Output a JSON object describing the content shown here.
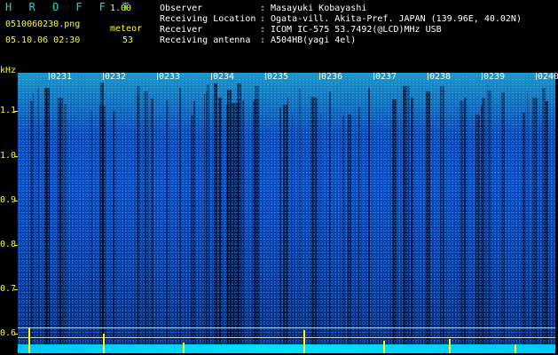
{
  "header": {
    "app_title": "H R O F F T",
    "version": "1.00",
    "filename": "0510060230.png",
    "meteor_label": "meteor",
    "datetime": "05.10.06 02:30",
    "meteor_count": "53"
  },
  "info": [
    {
      "key": "Observer",
      "value": "Masayuki Kobayashi"
    },
    {
      "key": "Receiving Location",
      "value": "Ogata-vill. Akita-Pref. JAPAN (139.96E, 40.02N)"
    },
    {
      "key": "Receiver",
      "value": "ICOM IC-575 53.7492(@LCD)MHz USB"
    },
    {
      "key": "Receiving antenna",
      "value": "A504HB(yagi 4el)"
    }
  ],
  "axis": {
    "y_unit": "kHz",
    "y_ticks": [
      "1.1",
      "1.0",
      "0.9",
      "0.8",
      "0.7",
      "0.6"
    ],
    "x_ticks": [
      "0231",
      "0232",
      "0233",
      "0234",
      "0235",
      "0236",
      "0237",
      "0238",
      "0239",
      "0240"
    ]
  },
  "colors": {
    "label_yellow": "#ffff00",
    "info_white": "#ffffff",
    "title_cyan": "#00e0e0",
    "spectrogram_blue": "#0a47c0"
  }
}
